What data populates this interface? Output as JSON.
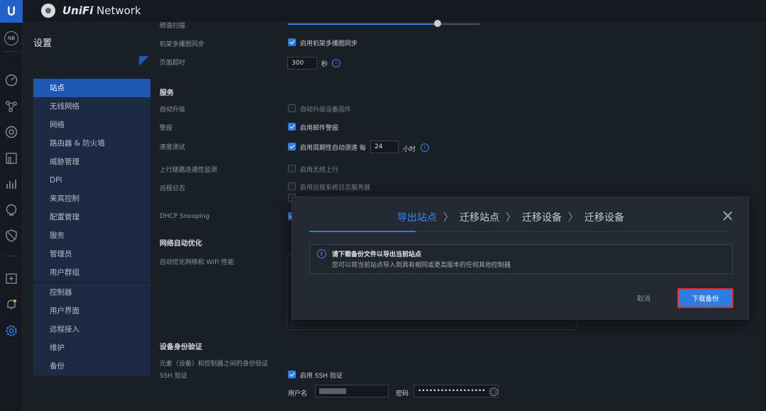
{
  "topbar": {
    "app_title_brand": "UniFi",
    "app_title_name": " Network"
  },
  "rail": {
    "badge": "NB",
    "icons": [
      "dashboard-icon",
      "topology-icon",
      "devices-icon",
      "clients-icon",
      "statistics-icon",
      "insights-icon",
      "threat-icon",
      "events-icon",
      "alerts-icon",
      "settings-icon"
    ]
  },
  "settings": {
    "title": "设置",
    "nav": [
      "站点",
      "无线网络",
      "网络",
      "路由器 & 防火墙",
      "威胁管理",
      "DPI",
      "来宾控制",
      "配置管理",
      "服务",
      "管理员",
      "用户群组",
      "控制器",
      "用户界面",
      "远程接入",
      "维护",
      "备份"
    ]
  },
  "form": {
    "row_top": "频谱扫描",
    "row_meshcast": "机架多播图同步",
    "meshcast_label": "启用机架多播图同步",
    "timeout_label": "页面超时",
    "timeout_value": "300",
    "timeout_unit": "秒",
    "services_title": "服务",
    "auto_upgrade_label": "自动升级",
    "auto_upgrade_check": "自动升级设备固件",
    "alerts_label": "警报",
    "alerts_check": "启用邮件警报",
    "speedtest_label": "速度测试",
    "speedtest_check": "启用周期性自动测速 每",
    "speedtest_value": "24",
    "speedtest_unit": "小时",
    "uplink_label": "上行链路连通性监测",
    "uplink_check": "启用无线上行",
    "syslog_label": "远程日志",
    "syslog_check": "启用远程系统日志服务器",
    "dhcp_label": "DHCP Snooping",
    "opt_title": "网络自动优化",
    "opt_label": "自动优化网络和 WiFi 性能",
    "auth_title": "设备身份验证",
    "auth_desc": "元素（设备）和控制器之间的身份验证",
    "ssh_label": "SSH 验证",
    "ssh_check": "启用 SSH 验证",
    "username_label": "用户名",
    "password_label": "密码",
    "password_value": "••••••••••••••••••"
  },
  "modal": {
    "steps": [
      "导出站点",
      "迁移站点",
      "迁移设备",
      "迁移设备"
    ],
    "notice_title": "请下载备份文件以导出当前站点",
    "notice_sub": "您可以将当前站点导入到具有相同或更高版本的任何其他控制器",
    "cancel": "取消",
    "primary": "下载备份"
  },
  "colors": {
    "accent": "#2f7de1",
    "highlight_border": "#e0302a",
    "nav_active": "#1f55b5"
  }
}
